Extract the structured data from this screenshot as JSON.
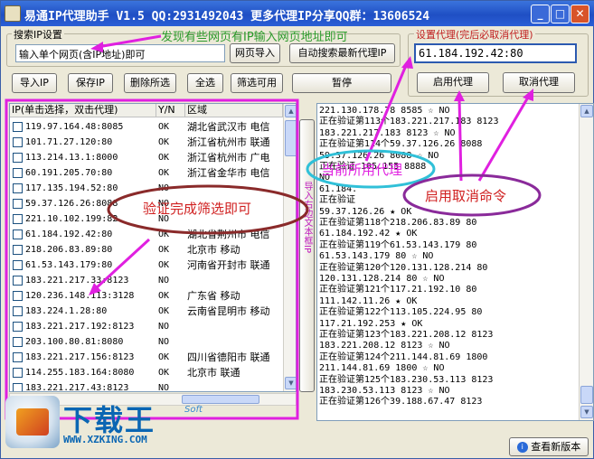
{
  "window": {
    "title": "易通IP代理助手 V1.5  QQ:2931492043  更多代理IP分享QQ群：13606524"
  },
  "search_group": {
    "legend": "搜索IP设置",
    "url_input_value": "输入单个网页(含IP地址)即可",
    "fetch_button": "网页导入",
    "auto_search_button": "自动搜索最新代理IP"
  },
  "proxy_group": {
    "legend": "设置代理(完后必取消代理)",
    "current_proxy": "61.184.192.42:80",
    "enable_button": "启用代理",
    "cancel_button": "取消代理"
  },
  "toolbar": {
    "import_ip": "导入IP",
    "save_ip": "保存IP",
    "delete_selected": "删除所选",
    "select_all": "全选",
    "filter_available": "筛选可用",
    "pause": "暂停"
  },
  "ip_table": {
    "headers": [
      "IP(单击选择，双击代理)",
      "Y/N",
      "区域"
    ],
    "rows": [
      {
        "ip": "119.97.164.48:8085",
        "yn": "OK",
        "region": "湖北省武汉市 电信"
      },
      {
        "ip": "101.71.27.120:80",
        "yn": "OK",
        "region": "浙江省杭州市 联通"
      },
      {
        "ip": "113.214.13.1:8000",
        "yn": "OK",
        "region": "浙江省杭州市 广电"
      },
      {
        "ip": "60.191.205.70:80",
        "yn": "OK",
        "region": "浙江省金华市 电信"
      },
      {
        "ip": "117.135.194.52:80",
        "yn": "NO",
        "region": ""
      },
      {
        "ip": "59.37.126.26:8088",
        "yn": "NO",
        "region": ""
      },
      {
        "ip": "221.10.102.199:82",
        "yn": "NO",
        "region": ""
      },
      {
        "ip": "61.184.192.42:80",
        "yn": "OK",
        "region": "湖北省荆州市 电信"
      },
      {
        "ip": "218.206.83.89:80",
        "yn": "OK",
        "region": "北京市 移动"
      },
      {
        "ip": "61.53.143.179:80",
        "yn": "OK",
        "region": "河南省开封市 联通"
      },
      {
        "ip": "183.221.217.33:8123",
        "yn": "NO",
        "region": ""
      },
      {
        "ip": "120.236.148.113:3128",
        "yn": "OK",
        "region": "广东省 移动"
      },
      {
        "ip": "183.224.1.28:80",
        "yn": "OK",
        "region": "云南省昆明市 移动"
      },
      {
        "ip": "183.221.217.192:8123",
        "yn": "NO",
        "region": ""
      },
      {
        "ip": "203.100.80.81:8080",
        "yn": "NO",
        "region": ""
      },
      {
        "ip": "183.221.217.156:8123",
        "yn": "OK",
        "region": "四川省德阳市 联通"
      },
      {
        "ip": "114.255.183.164:8080",
        "yn": "OK",
        "region": "北京市 联通"
      },
      {
        "ip": "183.221.217.43:8123",
        "yn": "NO",
        "region": ""
      }
    ]
  },
  "side_button": "导入右边文本框IP",
  "log_lines": [
    "221.130.178.78 8585   ☆ NO",
    "正在验证第113个183.221.217.183 8123",
    "183.221.217.183 8123  ☆ NO",
    "正在验证第114个59.37.126.26 8088",
    "59.37.126.26 8088     ☆ NO",
    "正在验证         105.155 8888",
    "                       NO",
    "61.184.",
    "正在验证",
    "59.37.126.26       ★ OK",
    "正在验证第118个218.206.83.89 80",
    "61.184.192.42      ★ OK",
    "正在验证第119个61.53.143.179 80",
    "61.53.143.179 80      ☆ NO",
    "正在验证第120个120.131.128.214 80",
    "120.131.128.214 80    ☆ NO",
    "正在验证第121个117.21.192.10 80",
    "111.142.11.26        ★ OK",
    "正在验证第122个113.105.224.95 80",
    "117.21.192.253       ★ OK",
    "正在验证第123个183.221.208.12 8123",
    "183.221.208.12 8123   ☆ NO",
    "正在验证第124个211.144.81.69 1800",
    "211.144.81.69 1800    ☆ NO",
    "正在验证第125个183.230.53.113 8123",
    "183.230.53.113 8123   ☆ NO",
    "正在验证第126个39.188.67.47 8123"
  ],
  "annotations": {
    "hint_top": "发现有些网页有IP输入网页地址即可",
    "filter_hint": "验证完成筛选即可",
    "current_proxy_hint": "当前所用代理",
    "command_hint": "启用取消命令"
  },
  "footer": {
    "new_version_button": "查看新版本"
  },
  "watermark": {
    "brand": "下载王",
    "side": "Soft",
    "url": "WWW.XZKING.COM"
  },
  "colors": {
    "annotation_pink": "#e020e0",
    "annotation_green": "#2a9a2a",
    "annotation_red": "#d02020",
    "ellipse_brown": "#8a2a2a",
    "ellipse_cyan": "#30c0d8",
    "ellipse_purple": "#8a2a9a",
    "titlebar_blue": "#245edb",
    "watermark_blue": "#0a66b3"
  }
}
